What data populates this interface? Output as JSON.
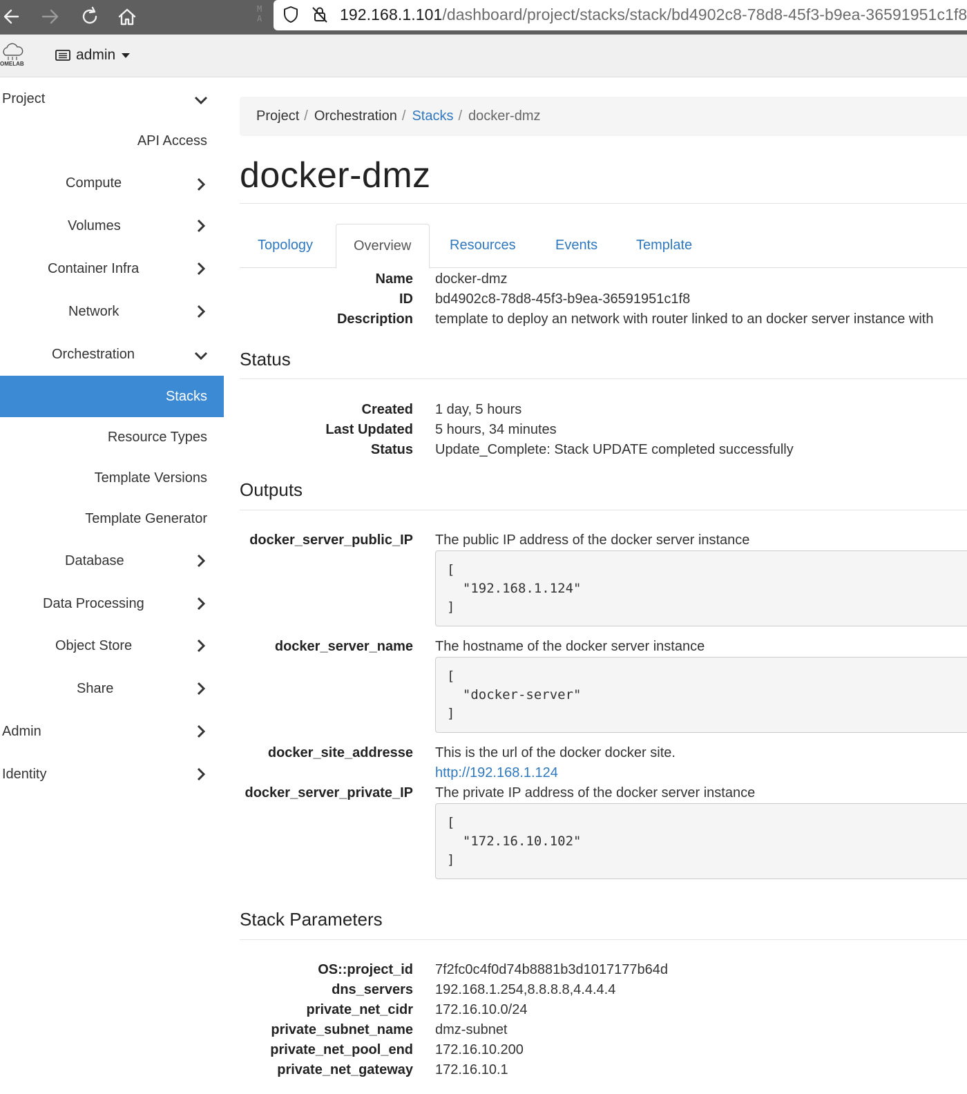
{
  "browser": {
    "url_host": "192.168.1.101",
    "url_path": "/dashboard/project/stacks/stack/bd4902c8-78d8-45f3-b9ea-36591951c1f8"
  },
  "topnav": {
    "logo_text": "OMELAB",
    "project_name": "admin"
  },
  "sidebar": {
    "items": [
      {
        "label": "Project"
      },
      {
        "label": "API Access"
      },
      {
        "label": "Compute"
      },
      {
        "label": "Volumes"
      },
      {
        "label": "Container Infra"
      },
      {
        "label": "Network"
      },
      {
        "label": "Orchestration"
      },
      {
        "label": "Stacks"
      },
      {
        "label": "Resource Types"
      },
      {
        "label": "Template Versions"
      },
      {
        "label": "Template Generator"
      },
      {
        "label": "Database"
      },
      {
        "label": "Data Processing"
      },
      {
        "label": "Object Store"
      },
      {
        "label": "Share"
      },
      {
        "label": "Admin"
      },
      {
        "label": "Identity"
      }
    ]
  },
  "breadcrumb": {
    "items": [
      "Project",
      "Orchestration",
      "Stacks",
      "docker-dmz"
    ],
    "separator": "/"
  },
  "page_title": "docker-dmz",
  "tabs": [
    "Topology",
    "Overview",
    "Resources",
    "Events",
    "Template"
  ],
  "overview": {
    "labels": {
      "name": "Name",
      "id": "ID",
      "description": "Description"
    },
    "name": "docker-dmz",
    "id": "bd4902c8-78d8-45f3-b9ea-36591951c1f8",
    "description": "template to deploy an network with router linked to an docker server instance with"
  },
  "status_section": {
    "heading": "Status",
    "labels": {
      "created": "Created",
      "last_updated": "Last Updated",
      "status": "Status"
    },
    "created": "1 day, 5 hours",
    "last_updated": "5 hours, 34 minutes",
    "status": "Update_Complete: Stack UPDATE completed successfully"
  },
  "outputs_section": {
    "heading": "Outputs",
    "items": [
      {
        "key": "docker_server_public_IP",
        "description": "The public IP address of the docker server instance",
        "value": "[\n  \"192.168.1.124\"\n]"
      },
      {
        "key": "docker_server_name",
        "description": "The hostname of the docker server instance",
        "value": "[\n  \"docker-server\"\n]"
      },
      {
        "key": "docker_site_addresse",
        "description": "This is the url of the docker docker site.",
        "link": "http://192.168.1.124"
      },
      {
        "key": "docker_server_private_IP",
        "description": "The private IP address of the docker server instance",
        "value": "[\n  \"172.16.10.102\"\n]"
      }
    ]
  },
  "parameters_section": {
    "heading": "Stack Parameters",
    "items": [
      {
        "key": "OS::project_id",
        "value": "7f2fc0c4f0d74b8881b3d1017177b64d"
      },
      {
        "key": "dns_servers",
        "value": "192.168.1.254,8.8.8.8,4.4.4.4"
      },
      {
        "key": "private_net_cidr",
        "value": "172.16.10.0/24"
      },
      {
        "key": "private_subnet_name",
        "value": "dmz-subnet"
      },
      {
        "key": "private_net_pool_end",
        "value": "172.16.10.200"
      },
      {
        "key": "private_net_gateway",
        "value": "172.16.10.1"
      }
    ]
  },
  "colors": {
    "accent": "#3c8ad3",
    "link": "#2e78bf"
  }
}
